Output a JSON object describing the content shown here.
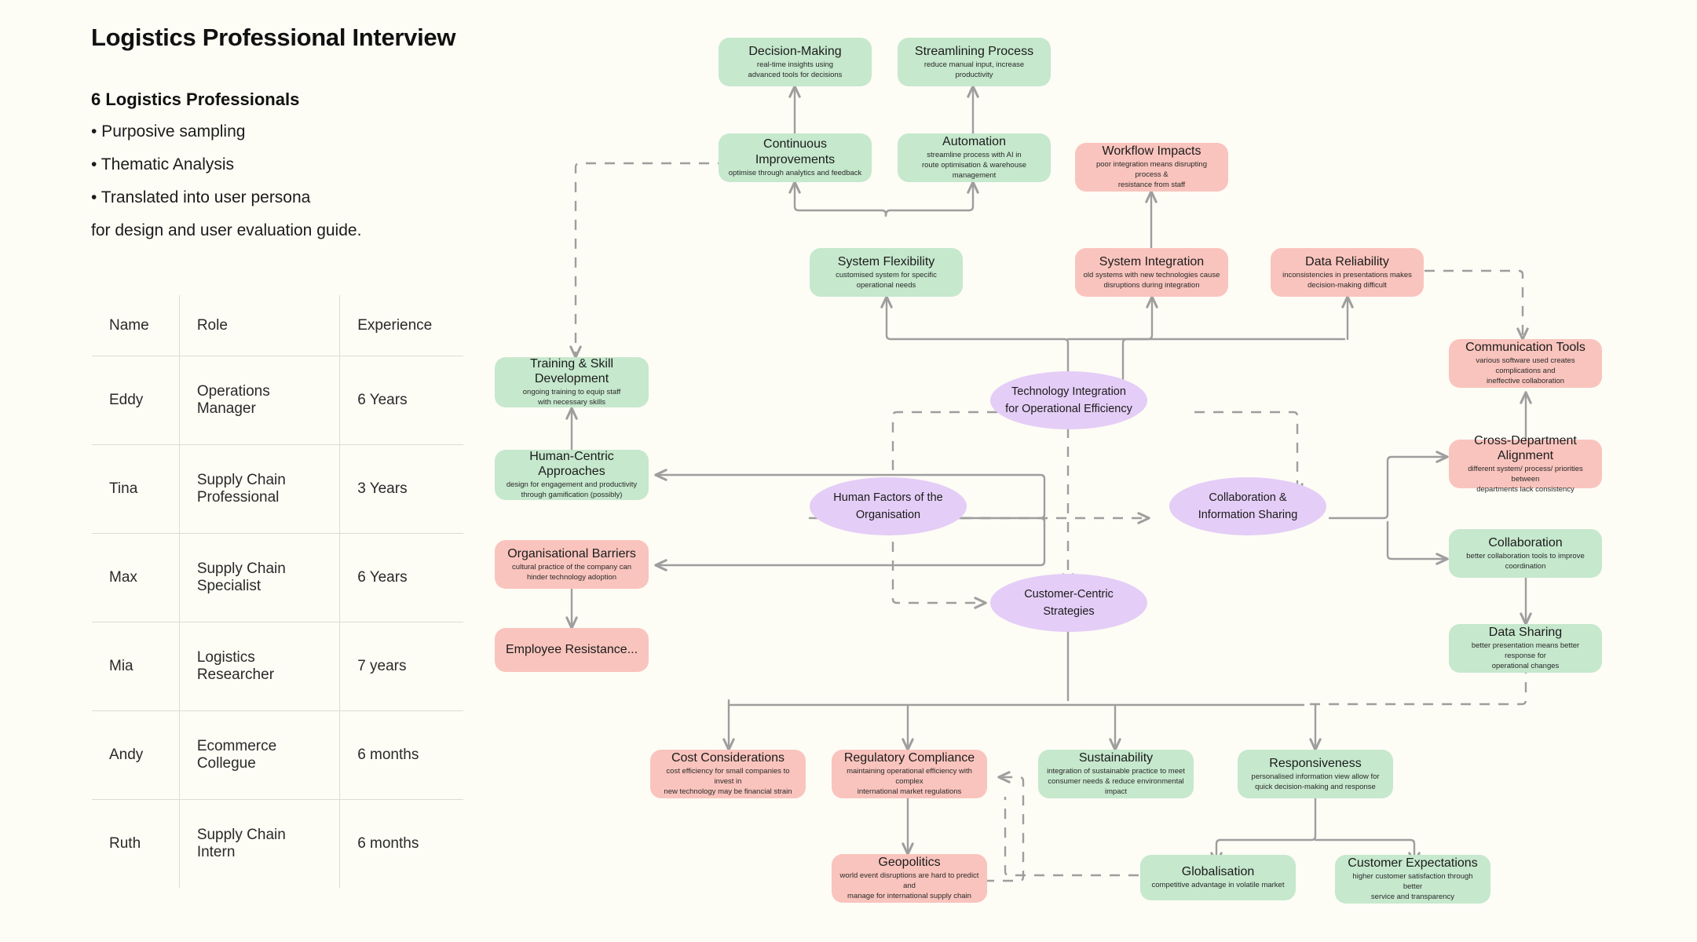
{
  "header": {
    "title": "Logistics Professional Interview",
    "summary_heading": "6 Logistics Professionals",
    "summary_lines": [
      "• Purposive sampling",
      "• Thematic Analysis",
      "• Translated into user persona",
      "for design and user evaluation guide."
    ]
  },
  "table": {
    "columns": [
      "Name",
      "Role",
      "Experience"
    ],
    "rows": [
      {
        "name": "Eddy",
        "role": "Operations Manager",
        "experience": "6 Years"
      },
      {
        "name": "Tina",
        "role": "Supply Chain Professional",
        "experience": "3 Years"
      },
      {
        "name": "Max",
        "role": "Supply Chain Specialist",
        "experience": "6 Years"
      },
      {
        "name": "Mia",
        "role": "Logistics Researcher",
        "experience": "7 years"
      },
      {
        "name": "Andy",
        "role": "Ecommerce Collegue",
        "experience": "6 months"
      },
      {
        "name": "Ruth",
        "role": "Supply Chain Intern",
        "experience": "6 months"
      }
    ]
  },
  "colors": {
    "background": "#fdfcf5",
    "green": "#c6e8cd",
    "pink": "#f9c4bd",
    "purple": "#e4cdf6",
    "edge": "#9e9e9e"
  },
  "diagram": {
    "themes": [
      {
        "id": "technology-integration",
        "label": "Technology Integration\nfor Operational Efficiency",
        "color": "purple"
      },
      {
        "id": "human-factors",
        "label": "Human Factors of the\nOrganisation",
        "color": "purple"
      },
      {
        "id": "collaboration-info-sharing",
        "label": "Collaboration &\nInformation Sharing",
        "color": "purple"
      },
      {
        "id": "customer-centric-strategies",
        "label": "Customer-Centric\nStrategies",
        "color": "purple"
      }
    ],
    "nodes": [
      {
        "id": "decision-making",
        "title": "Decision-Making",
        "desc": "real-time insights using\nadvanced tools for decisions",
        "color": "green"
      },
      {
        "id": "streamlining-process",
        "title": "Streamlining Process",
        "desc": "reduce manual input, increase productivity",
        "color": "green"
      },
      {
        "id": "continuous-improvements",
        "title": "Continuous Improvements",
        "desc": "optimise through analytics and feedback",
        "color": "green"
      },
      {
        "id": "automation",
        "title": "Automation",
        "desc": "streamline process with AI in\nroute optimisation & warehouse management",
        "color": "green"
      },
      {
        "id": "workflow-impacts",
        "title": "Workflow Impacts",
        "desc": "poor integration means disrupting process &\nresistance from staff",
        "color": "pink"
      },
      {
        "id": "system-flexibility",
        "title": "System Flexibility",
        "desc": "customised system for specific operational needs",
        "color": "green"
      },
      {
        "id": "system-integration",
        "title": "System Integration",
        "desc": "old systems with new technologies cause\ndisruptions during integration",
        "color": "pink"
      },
      {
        "id": "data-reliability",
        "title": "Data Reliability",
        "desc": "inconsistencies in presentations makes\ndecision-making difficult",
        "color": "pink"
      },
      {
        "id": "communication-tools",
        "title": "Communication Tools",
        "desc": "various software used creates complications and\nineffective collaboration",
        "color": "pink"
      },
      {
        "id": "training-skill-development",
        "title": "Training & Skill Development",
        "desc": "ongoing training to equip staff\nwith necessary skills",
        "color": "green"
      },
      {
        "id": "cross-department-alignment",
        "title": "Cross-Department Alignment",
        "desc": "different system/ process/ priorities between\ndepartments lack consistency",
        "color": "pink"
      },
      {
        "id": "human-centric-approaches",
        "title": "Human-Centric Approaches",
        "desc": "design for engagement and productivity\nthrough gamification (possibly)",
        "color": "green"
      },
      {
        "id": "collaboration",
        "title": "Collaboration",
        "desc": "better collaboration tools to improve coordination",
        "color": "green"
      },
      {
        "id": "organisational-barriers",
        "title": "Organisational Barriers",
        "desc": "cultural practice of the company can\nhinder technology adoption",
        "color": "pink"
      },
      {
        "id": "data-sharing",
        "title": "Data Sharing",
        "desc": "better presentation means better response for\noperational changes",
        "color": "green"
      },
      {
        "id": "employee-resistance",
        "title": "Employee Resistance...",
        "desc": "",
        "color": "pink"
      },
      {
        "id": "cost-considerations",
        "title": "Cost Considerations",
        "desc": "cost efficiency for small companies to invest in\nnew technology may be financial strain",
        "color": "pink"
      },
      {
        "id": "regulatory-compliance",
        "title": "Regulatory Compliance",
        "desc": "maintaining operational efficiency with complex\ninternational market regulations",
        "color": "pink"
      },
      {
        "id": "sustainability",
        "title": "Sustainability",
        "desc": "integration of sustainable practice to meet\nconsumer needs & reduce environmental impact",
        "color": "green"
      },
      {
        "id": "responsiveness",
        "title": "Responsiveness",
        "desc": "personalised information view allow for\nquick decision-making and response",
        "color": "green"
      },
      {
        "id": "geopolitics",
        "title": "Geopolitics",
        "desc": "world event disruptions are hard to predict and\nmanage for international supply chain",
        "color": "pink"
      },
      {
        "id": "globalisation",
        "title": "Globalisation",
        "desc": "competitive advantage in volatile market",
        "color": "green"
      },
      {
        "id": "customer-expectations",
        "title": "Customer Expectations",
        "desc": "higher customer satisfaction through better\nservice and transparency",
        "color": "green"
      }
    ]
  }
}
